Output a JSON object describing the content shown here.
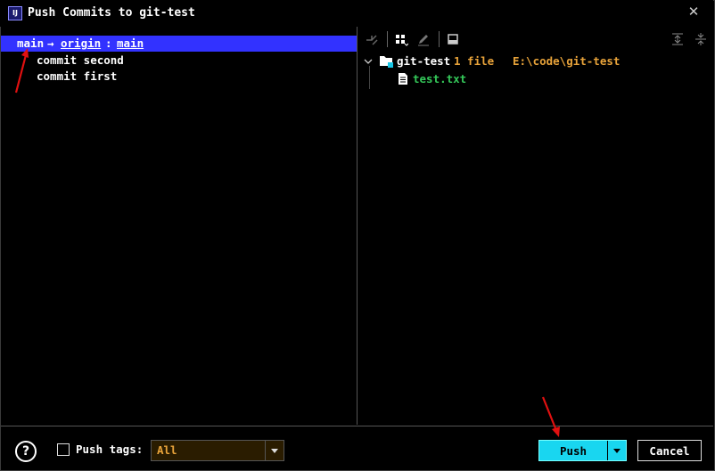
{
  "window": {
    "logo_text": "IJ",
    "title": "Push Commits to git-test"
  },
  "branch": {
    "local": "main",
    "arrow": "→",
    "remote": "origin",
    "separator": ":",
    "remote_branch": "main"
  },
  "commits": [
    "commit second",
    "commit first"
  ],
  "changes": {
    "repo_name": "git-test",
    "file_count": "1 file",
    "repo_path": "E:\\code\\git-test",
    "files": [
      {
        "name": "test.txt",
        "color": "#34c759"
      }
    ]
  },
  "footer": {
    "help_symbol": "?",
    "push_tags_label": "Push tags:",
    "push_tags_value": "All",
    "push_label": "Push",
    "cancel_label": "Cancel"
  },
  "colors": {
    "selection": "#3232ff",
    "path_orange": "#e8a33a",
    "push_accent": "#19d6f0",
    "annotation_red": "#e01010"
  }
}
